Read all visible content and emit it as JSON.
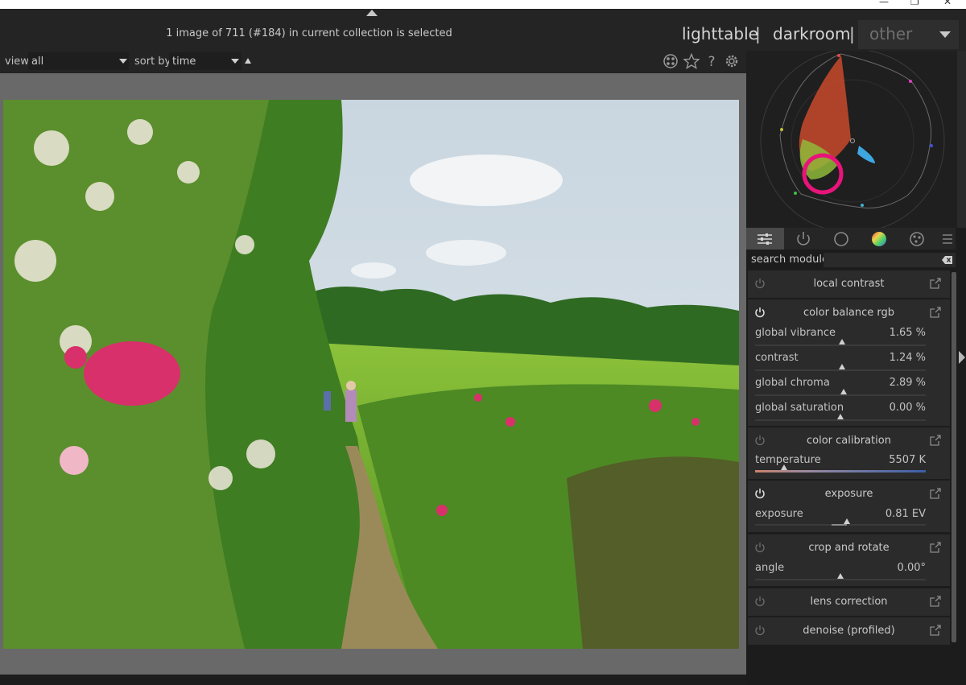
{
  "status_text": "1 image of 711 (#184) in current collection is selected",
  "views": {
    "lighttable": "lighttable",
    "darkroom": "darkroom",
    "other": "other",
    "separator": "|"
  },
  "toolbar": {
    "view_label": "view",
    "view_value": "all",
    "sort_label": "sort by",
    "sort_value": "time",
    "icons": [
      "grouping-icon",
      "star-icon",
      "help-icon",
      "gear-icon"
    ]
  },
  "photo": {
    "description_icon": "garden-path-photo",
    "sky_color": "#cfdbe4",
    "foliage_color": "#5f9a2a",
    "flower_color": "#d8306a"
  },
  "right_panel": {
    "tabs": [
      "quick-access-icon",
      "active-modules-icon",
      "base-modules-icon",
      "color-modules-icon",
      "effects-modules-icon",
      "menu-icon"
    ],
    "search": {
      "label": "search module",
      "value": "",
      "placeholder": ""
    },
    "modules": [
      {
        "title": "local contrast",
        "expanded": false,
        "enabled": false
      },
      {
        "title": "color balance rgb",
        "expanded": true,
        "enabled": true,
        "params": [
          {
            "label": "global vibrance",
            "value": "1.65 %",
            "pos": 0.51
          },
          {
            "label": "contrast",
            "value": "1.24 %",
            "pos": 0.51
          },
          {
            "label": "global chroma",
            "value": "2.89 %",
            "pos": 0.52
          },
          {
            "label": "global saturation",
            "value": "0.00 %",
            "pos": 0.5
          }
        ]
      },
      {
        "title": "color calibration",
        "expanded": true,
        "enabled": false,
        "params": [
          {
            "label": "temperature",
            "value": "5507 K",
            "pos": 0.17
          }
        ]
      },
      {
        "title": "exposure",
        "expanded": true,
        "enabled": true,
        "params": [
          {
            "label": "exposure",
            "value": "0.81 EV",
            "pos": 0.54
          }
        ]
      },
      {
        "title": "crop and rotate",
        "expanded": true,
        "enabled": false,
        "params": [
          {
            "label": "angle",
            "value": "0.00°",
            "pos": 0.5
          }
        ]
      },
      {
        "title": "lens correction",
        "expanded": false,
        "enabled": false
      },
      {
        "title": "denoise (profiled)",
        "expanded": false,
        "enabled": false
      }
    ]
  },
  "colors": {
    "accent_ring": "#e8147a",
    "panel_bg": "#2b2b2b",
    "app_bg": "#1b1b1b"
  }
}
